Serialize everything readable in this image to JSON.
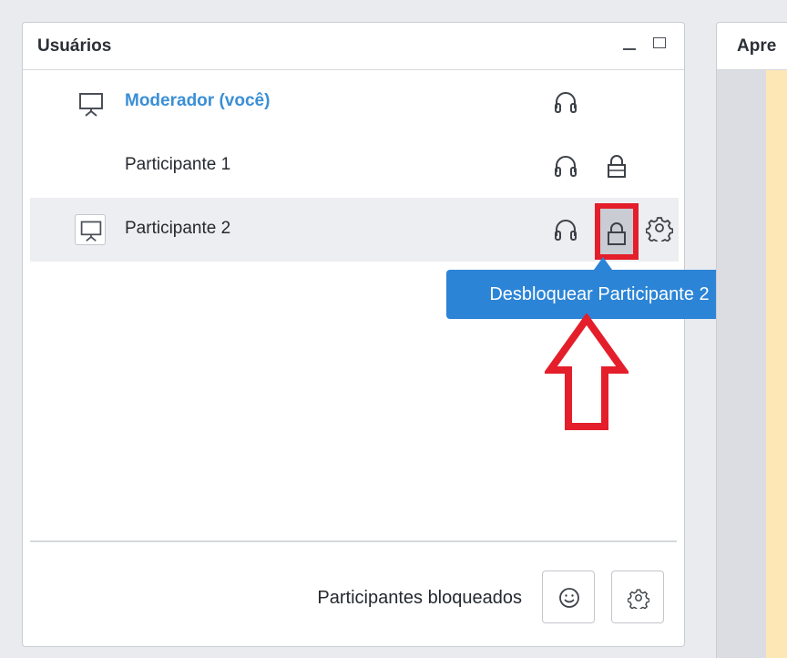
{
  "users_panel": {
    "title": "Usuários",
    "users": [
      {
        "name": "Moderador (você)",
        "is_me": true,
        "presenter": true,
        "headset": true,
        "lock": false
      },
      {
        "name": "Participante 1",
        "is_me": false,
        "presenter": false,
        "headset": true,
        "lock": true
      },
      {
        "name": "Participante 2",
        "is_me": false,
        "presenter": true,
        "headset": true,
        "lock": true,
        "selected": true,
        "settings": true
      }
    ]
  },
  "tooltip": {
    "text": "Desbloquear Participante 2"
  },
  "footer": {
    "label": "Participantes bloqueados"
  },
  "right_panel": {
    "title": "Apre"
  },
  "colors": {
    "accent": "#2b84d6",
    "moderator": "#3a8fd6",
    "highlight": "#e41e2a",
    "presentation_bg": "#fde7b4"
  },
  "icons": [
    "presentation-icon",
    "headset-icon",
    "lock-icon",
    "gear-icon",
    "smiley-icon",
    "minimize-icon",
    "maximize-icon"
  ]
}
